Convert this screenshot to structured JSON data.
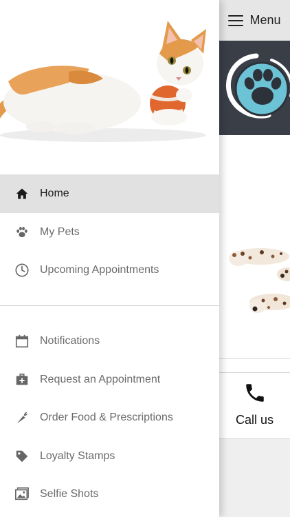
{
  "header": {
    "menu_label": "Menu",
    "menu_icon": "hamburger-icon"
  },
  "content": {
    "call_us_label": "Call us",
    "call_icon": "phone-icon"
  },
  "drawer": {
    "primary_items": [
      {
        "label": "Home",
        "icon": "home-icon",
        "active": true
      },
      {
        "label": "My Pets",
        "icon": "paw-icon",
        "active": false
      },
      {
        "label": "Upcoming Appointments",
        "icon": "clock-icon",
        "active": false
      }
    ],
    "secondary_items": [
      {
        "label": "Notifications",
        "icon": "calendar-icon"
      },
      {
        "label": "Request an Appointment",
        "icon": "medical-bag-icon"
      },
      {
        "label": "Order Food & Prescriptions",
        "icon": "carrot-icon"
      },
      {
        "label": "Loyalty Stamps",
        "icon": "tag-icon"
      },
      {
        "label": "Selfie Shots",
        "icon": "photos-icon"
      }
    ]
  },
  "colors": {
    "active_item_bg": "#e1e1e1",
    "logo_bg": "#3a3e47",
    "logo_paw": "#6cc3d5",
    "menu_bar_bg": "#e6e6e6"
  }
}
